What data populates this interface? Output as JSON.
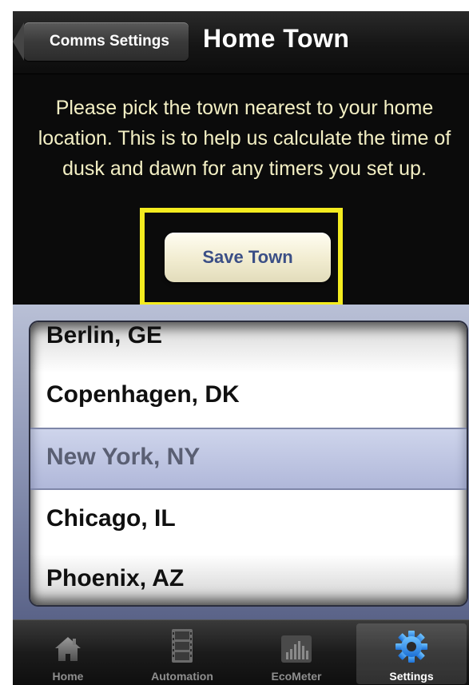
{
  "navbar": {
    "back_label": "Comms Settings",
    "title": "Home Town"
  },
  "instructions": {
    "text": "Please pick the town nearest to your home location. This is to help us calculate the time of dusk and dawn for any timers you set up."
  },
  "save_button": {
    "label": "Save Town"
  },
  "highlight_color": "#f4ec1f",
  "picker": {
    "rows": [
      {
        "label": "Berlin, GE"
      },
      {
        "label": "Copenhagen, DK"
      },
      {
        "label": "New York, NY"
      },
      {
        "label": "Chicago, IL"
      },
      {
        "label": "Phoenix, AZ"
      }
    ],
    "selected": "New York, NY"
  },
  "tabbar": {
    "tabs": [
      {
        "label": "Home",
        "icon": "home-icon"
      },
      {
        "label": "Automation",
        "icon": "film-icon"
      },
      {
        "label": "EcoMeter",
        "icon": "bar-meter-icon"
      },
      {
        "label": "Settings",
        "icon": "gear-icon"
      }
    ],
    "active": "Settings"
  }
}
